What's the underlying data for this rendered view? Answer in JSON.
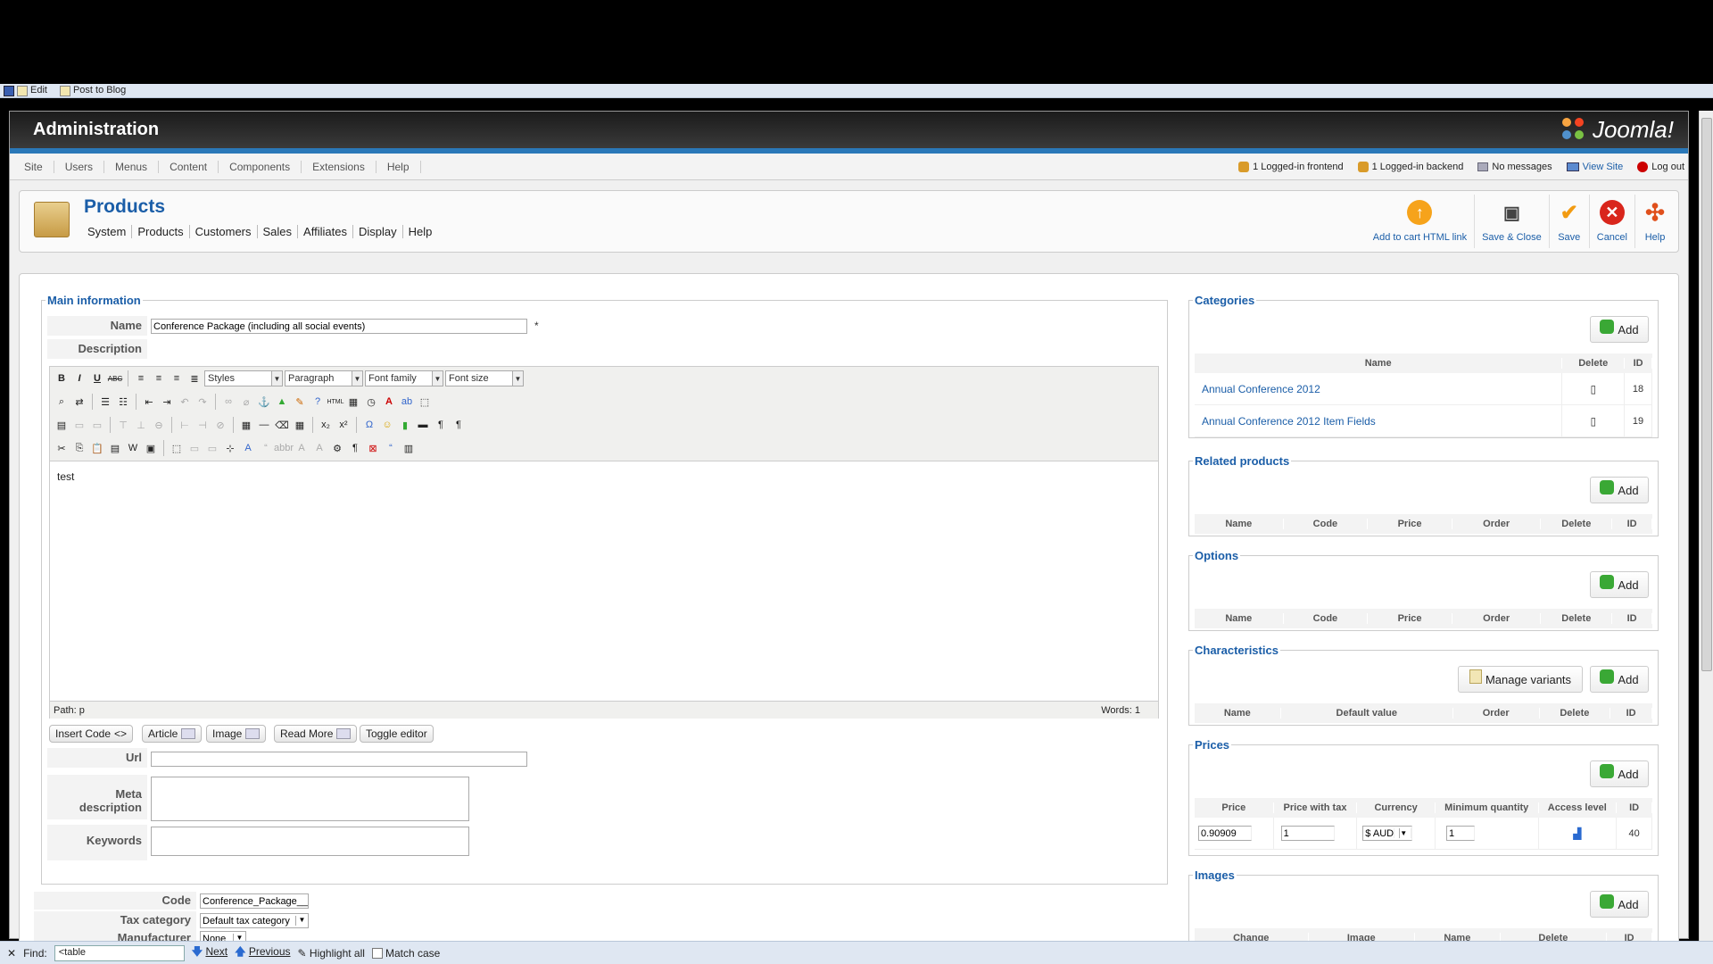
{
  "browser": {
    "edit_label": "Edit",
    "blog_label": "Post to Blog",
    "find_label": "Find:",
    "find_value": "<table",
    "next_label": "Next",
    "previous_label": "Previous",
    "highlight_label": "Highlight all",
    "match_case_label": "Match case"
  },
  "header": {
    "title": "Administration",
    "logo_text": "Joomla!"
  },
  "menu": [
    "Site",
    "Users",
    "Menus",
    "Content",
    "Components",
    "Extensions",
    "Help"
  ],
  "status": {
    "frontend": "1 Logged-in frontend",
    "backend": "1 Logged-in backend",
    "messages": "No messages",
    "view_site": "View Site",
    "logout": "Log out"
  },
  "page": {
    "title": "Products",
    "submenu": [
      "System",
      "Products",
      "Customers",
      "Sales",
      "Affiliates",
      "Display",
      "Help"
    ]
  },
  "toolbar": {
    "add_cart": "Add to cart HTML link",
    "save_close": "Save & Close",
    "save": "Save",
    "cancel": "Cancel",
    "help": "Help"
  },
  "main": {
    "legend": "Main information",
    "name_label": "Name",
    "name_value": "Conference Package (including all social events)",
    "required_mark": "*",
    "description_label": "Description",
    "editor": {
      "styles": "Styles",
      "paragraph": "Paragraph",
      "font_family": "Font family",
      "font_size": "Font size",
      "content": "test",
      "path": "Path: p",
      "words": "Words: 1"
    },
    "editor_buttons": [
      "Insert Code",
      "Article",
      "Image",
      "Read More",
      "Toggle editor"
    ],
    "url_label": "Url",
    "meta_label": "Meta description",
    "keywords_label": "Keywords",
    "code_label": "Code",
    "code_value": "Conference_Package__i",
    "tax_label": "Tax category",
    "tax_value": "Default tax category",
    "manufacturer_label": "Manufacturer",
    "manufacturer_value": "None"
  },
  "categories": {
    "legend": "Categories",
    "add": "Add",
    "cols": [
      "Name",
      "Delete",
      "ID"
    ],
    "rows": [
      {
        "name": "Annual Conference 2012",
        "id": "18"
      },
      {
        "name": "Annual Conference 2012 Item Fields",
        "id": "19"
      }
    ]
  },
  "related": {
    "legend": "Related products",
    "add": "Add",
    "cols": [
      "Name",
      "Code",
      "Price",
      "Order",
      "Delete",
      "ID"
    ]
  },
  "options": {
    "legend": "Options",
    "add": "Add",
    "cols": [
      "Name",
      "Code",
      "Price",
      "Order",
      "Delete",
      "ID"
    ]
  },
  "characteristics": {
    "legend": "Characteristics",
    "manage": "Manage variants",
    "add": "Add",
    "cols": [
      "Name",
      "Default value",
      "Order",
      "Delete",
      "ID"
    ]
  },
  "prices": {
    "legend": "Prices",
    "add": "Add",
    "cols": [
      "Price",
      "Price with tax",
      "Currency",
      "Minimum quantity",
      "Access level",
      "ID"
    ],
    "row": {
      "price": "0.90909",
      "price_tax": "1",
      "currency": "$ AUD",
      "min_qty": "1",
      "id": "40"
    }
  },
  "images": {
    "legend": "Images",
    "add": "Add",
    "cols": [
      "Change",
      "Image",
      "Name",
      "Delete",
      "ID"
    ]
  }
}
